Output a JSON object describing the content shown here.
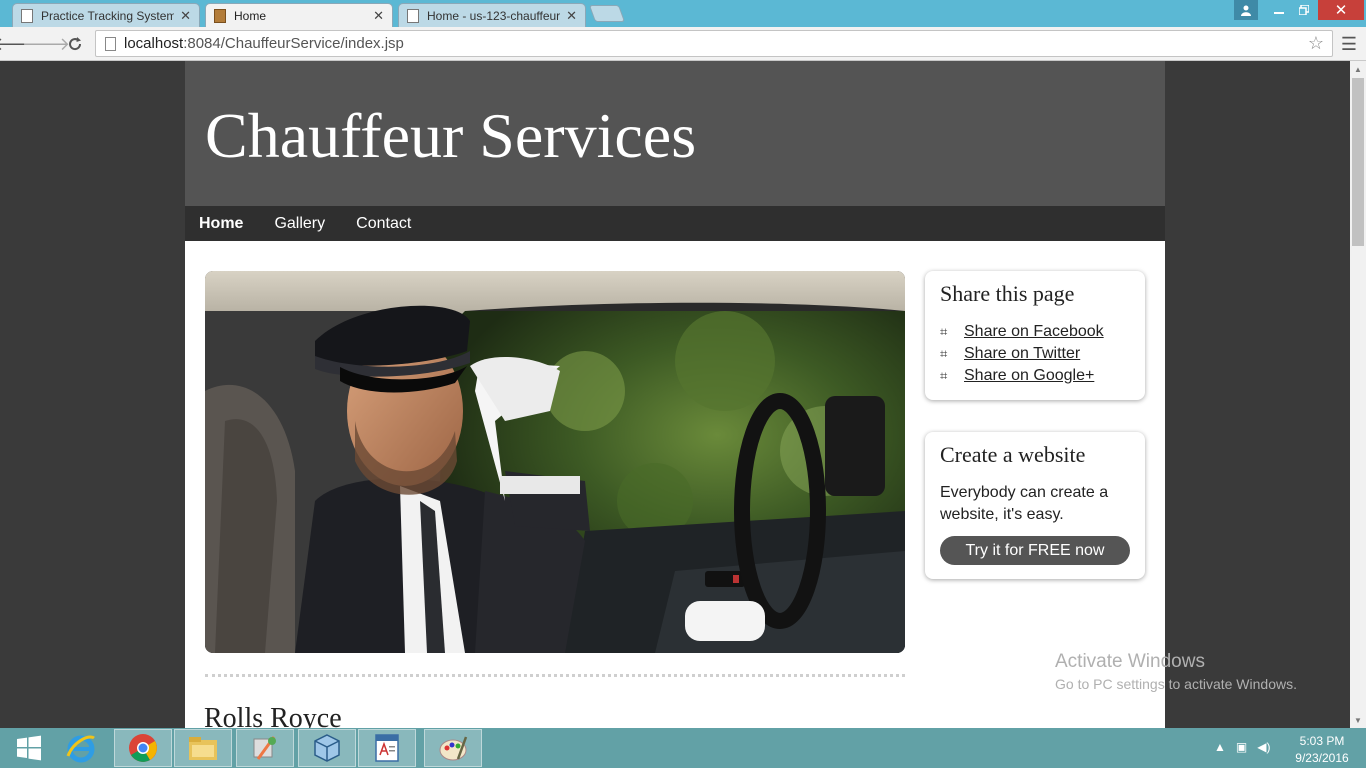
{
  "browser": {
    "tabs": [
      {
        "title": "Practice Tracking System",
        "active": false
      },
      {
        "title": "Home",
        "active": true
      },
      {
        "title": "Home - us-123-chauffeur",
        "active": false
      }
    ],
    "url_host": "localhost",
    "url_rest": ":8084/ChauffeurService/index.jsp"
  },
  "site": {
    "title": "Chauffeur Services",
    "nav": [
      "Home",
      "Gallery",
      "Contact"
    ],
    "active_nav": "Home",
    "section_heading": "Rolls Royce"
  },
  "share_widget": {
    "title": "Share this page",
    "links": [
      {
        "icon": "facebook-icon",
        "label": "Share on Facebook"
      },
      {
        "icon": "twitter-icon",
        "label": "Share on Twitter"
      },
      {
        "icon": "google-plus-icon",
        "label": "Share on Google+"
      }
    ]
  },
  "create_widget": {
    "title": "Create a website",
    "text": "Everybody can create a website, it's easy.",
    "button": "Try it for FREE now"
  },
  "watermark": {
    "line1": "Activate Windows",
    "line2": "Go to PC settings to activate Windows."
  },
  "taskbar": {
    "time": "5:03 PM",
    "date": "9/23/2016"
  },
  "colors": {
    "header_bg": "#545454",
    "nav_bg": "#2f2f2f",
    "button_bg": "#555555",
    "tabbar_bg": "#5bb8d4",
    "taskbar_bg": "#62a1a6"
  }
}
